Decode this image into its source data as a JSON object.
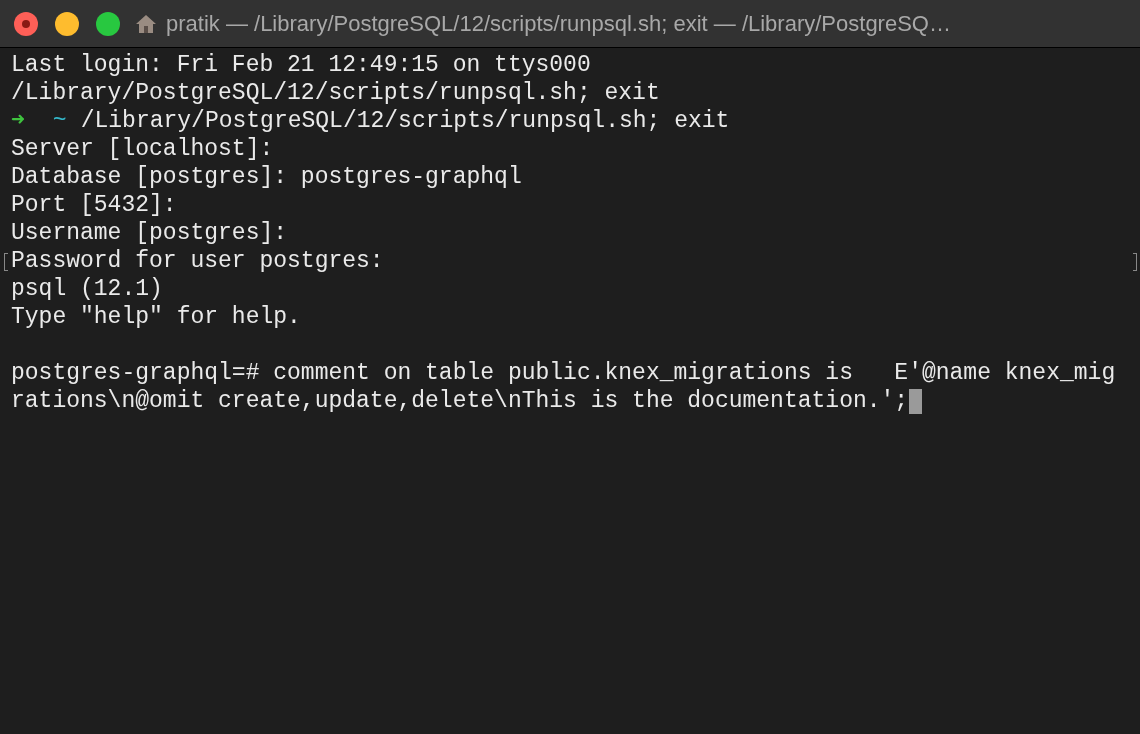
{
  "window": {
    "title": "pratik — /Library/PostgreSQL/12/scripts/runpsql.sh; exit — /Library/PostgreSQ…"
  },
  "lines": [
    {
      "kind": "text",
      "text": "Last login: Fri Feb 21 12:49:15 on ttys000"
    },
    {
      "kind": "text",
      "text": "/Library/PostgreSQL/12/scripts/runpsql.sh; exit"
    },
    {
      "kind": "prompt",
      "arrow": "➜",
      "dir": "~",
      "text": "/Library/PostgreSQL/12/scripts/runpsql.sh; exit"
    },
    {
      "kind": "text",
      "text": "Server [localhost]:"
    },
    {
      "kind": "text",
      "text": "Database [postgres]: postgres-graphql"
    },
    {
      "kind": "text",
      "text": "Port [5432]:"
    },
    {
      "kind": "text",
      "text": "Username [postgres]:"
    },
    {
      "kind": "text",
      "text": "Password for user postgres:",
      "marked": true
    },
    {
      "kind": "text",
      "text": "psql (12.1)"
    },
    {
      "kind": "text",
      "text": "Type \"help\" for help."
    },
    {
      "kind": "blank"
    },
    {
      "kind": "text",
      "text": "postgres-graphql=# comment on table public.knex_migrations is   E'@name knex_mig"
    },
    {
      "kind": "text",
      "text": "rations\\n@omit create,update,delete\\nThis is the documentation.';",
      "cursor": true
    }
  ]
}
